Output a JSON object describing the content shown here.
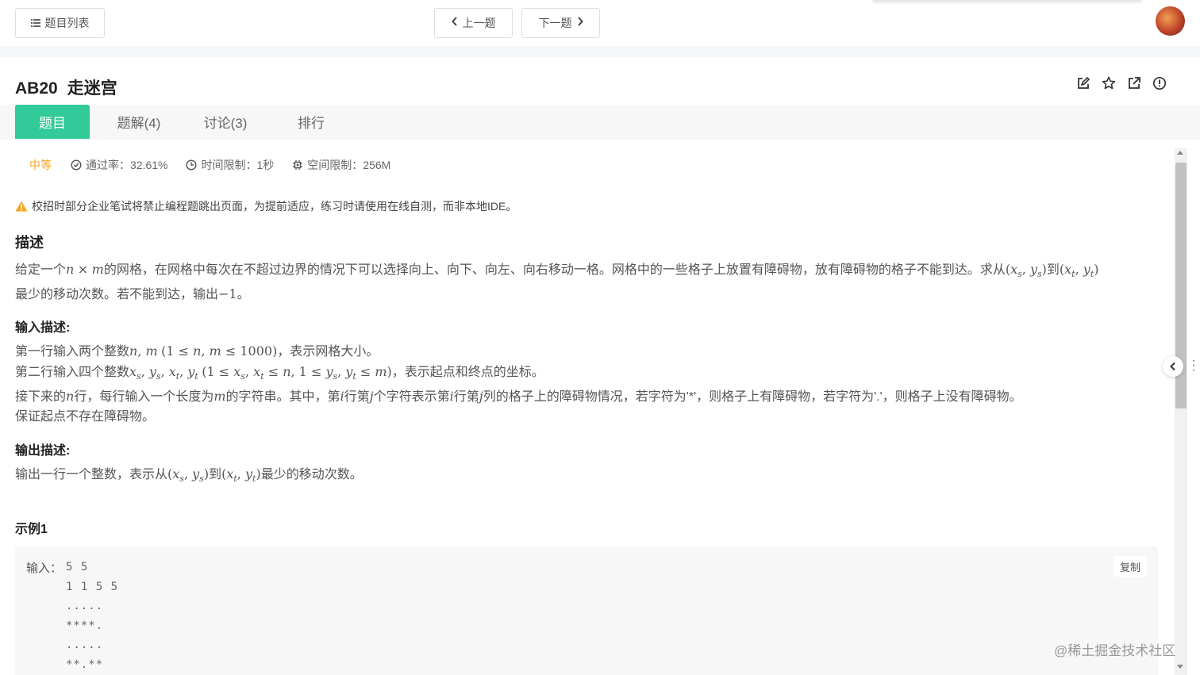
{
  "topbar": {
    "list_label": "题目列表",
    "prev_label": "上一题",
    "next_label": "下一题"
  },
  "problem": {
    "id": "AB20",
    "title": "走迷宫"
  },
  "tabs": [
    {
      "label": "题目"
    },
    {
      "label": "题解(4)"
    },
    {
      "label": "讨论(3)"
    },
    {
      "label": "排行"
    }
  ],
  "meta": {
    "difficulty": "中等",
    "pass_rate": "通过率：32.61%",
    "time_limit": "时间限制：1秒",
    "space_limit": "空间限制：256M"
  },
  "warning": "校招时部分企业笔试将禁止编程题跳出页面，为提前适应，练习时请使用在线自测，而非本地IDE。",
  "sections": {
    "desc_title": "描述",
    "input_title": "输入描述:",
    "output_title": "输出描述:",
    "example_title": "示例1"
  },
  "example": {
    "input_label": "输入：",
    "input_code": "5 5\n1 1 5 5\n.....\n****.\n.....\n**.**",
    "copy_label": "复制"
  },
  "watermark": "@稀土掘金技术社区",
  "colors": {
    "accent": "#32ca99",
    "difficulty": "#f5a623",
    "warning": "#f5a623"
  }
}
